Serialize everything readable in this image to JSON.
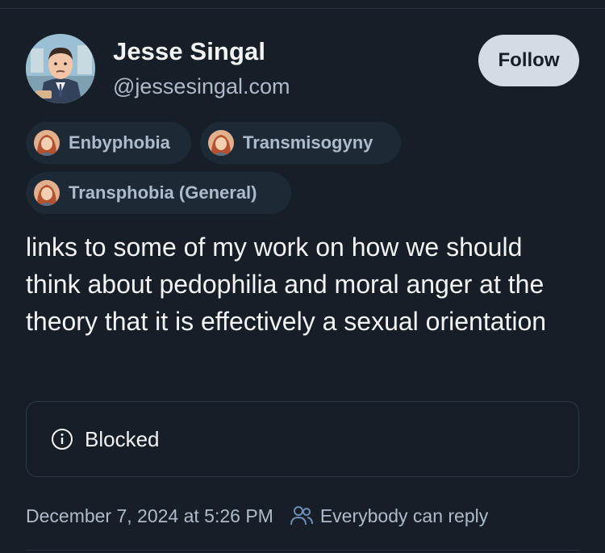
{
  "author": {
    "display_name": "Jesse Singal",
    "handle": "@jessesingal.com",
    "avatar_icon": "cartoon-man-avatar"
  },
  "follow_button": {
    "label": "Follow"
  },
  "labels": [
    {
      "text": "Enbyphobia",
      "icon": "labeler-avatar"
    },
    {
      "text": "Transmisogyny",
      "icon": "labeler-avatar"
    },
    {
      "text": "Transphobia (General)",
      "icon": "labeler-avatar"
    }
  ],
  "post": {
    "text": "links to some of my work on how we should think about pedophilia and moral anger at the theory that it is effectively a sexual orientation"
  },
  "embed": {
    "status_label": "Blocked",
    "icon": "info-icon"
  },
  "footer": {
    "timestamp": "December 7, 2024 at 5:26 PM",
    "reply_setting": "Everybody can reply",
    "reply_icon": "people-icon"
  },
  "colors": {
    "background": "#161e27",
    "text_primary": "#f1f3f5",
    "text_secondary": "#aebbc9",
    "chip_background": "#1e2936",
    "follow_button": "#d4dbe2",
    "accent": "#6d8fb5"
  }
}
